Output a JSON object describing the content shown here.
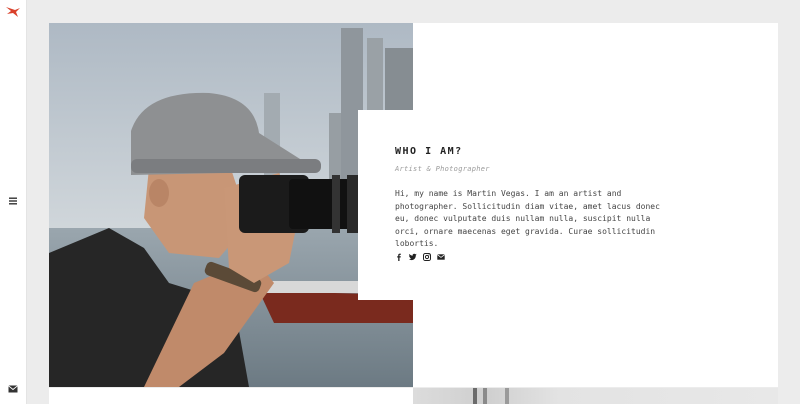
{
  "about": {
    "title": "WHO I AM?",
    "subtitle": "Artist & Photographer",
    "body": "Hi, my name is Martin Vegas. I am an artist and photographer. Sollicitudin diam vitae, amet lacus donec eu, donec vulputate duis nullam nulla, suscipit nulla orci, ornare maecenas eget gravida. Curae sollicitudin lobortis."
  },
  "sidebar": {
    "logo": "bird-logo",
    "menu_icon": "hamburger-menu-icon",
    "contact_icon": "envelope-icon"
  },
  "socials": [
    "facebook-icon",
    "twitter-icon",
    "instagram-icon",
    "envelope-icon"
  ],
  "colors": {
    "accent": "#d9412b",
    "background": "#ececec",
    "panel": "#ffffff",
    "text": "#222222"
  }
}
